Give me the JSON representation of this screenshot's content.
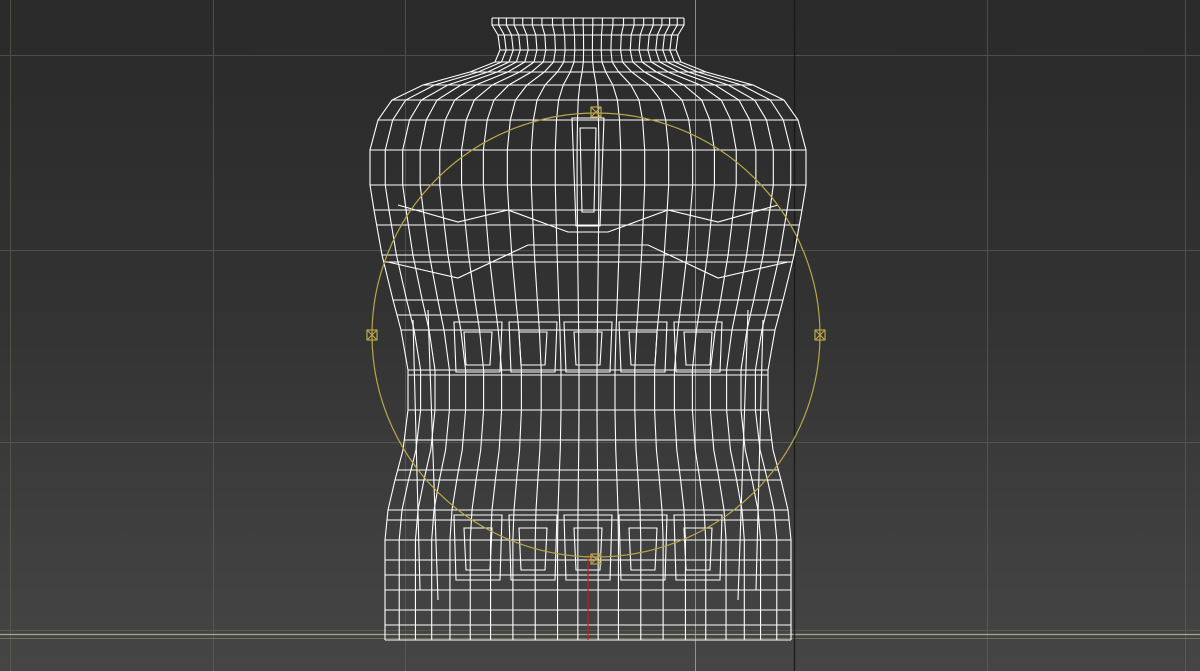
{
  "viewport": {
    "background_top": "#2a2a2a",
    "background_bottom": "#454545",
    "grid_color": "#6a6a5a",
    "home_grid_color": "#b8b89a",
    "mesh_color": "#ffffff",
    "gizmo_color": "#b8a64a",
    "pivot_axis_color": "#c81e1e"
  },
  "object": {
    "type": "bottle-wireframe-mesh",
    "selected": true
  },
  "gizmo": {
    "type": "scale-circle-gizmo",
    "handles": [
      "top",
      "left",
      "right",
      "bottom"
    ]
  }
}
